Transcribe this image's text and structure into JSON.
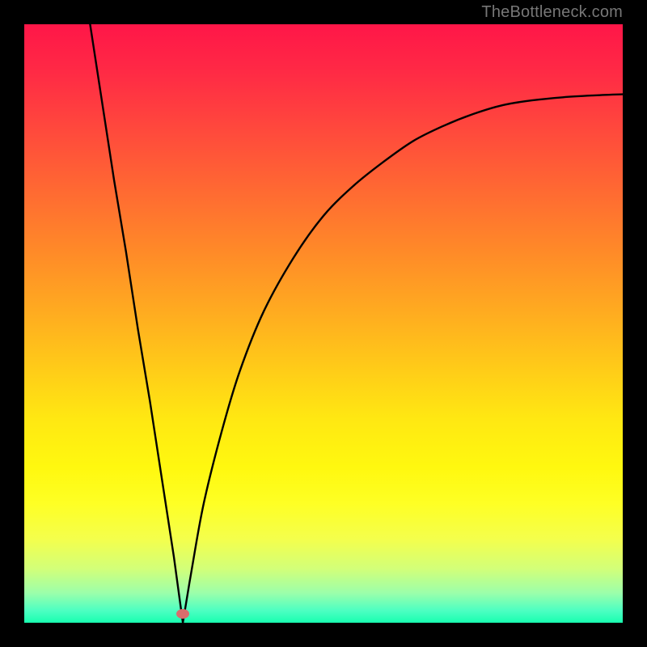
{
  "attribution": "TheBottleneck.com",
  "colors": {
    "frame": "#000000",
    "curve": "#000000",
    "marker": "#d96d6d"
  },
  "chart_data": {
    "type": "line",
    "title": "",
    "xlabel": "",
    "ylabel": "",
    "xlim": [
      0,
      100
    ],
    "ylim": [
      0,
      100
    ],
    "grid": false,
    "legend": false,
    "annotations": [
      {
        "text": "TheBottleneck.com",
        "position": "top-right"
      }
    ],
    "marker": {
      "x": 26.5,
      "y": 1.5,
      "shape": "ellipse",
      "color": "#d96d6d"
    },
    "series": [
      {
        "name": "bottleneck-curve",
        "x": [
          11,
          13,
          15,
          17,
          19,
          21,
          23,
          25,
          26.5,
          28,
          30,
          33,
          36,
          40,
          45,
          50,
          55,
          60,
          65,
          70,
          75,
          80,
          85,
          90,
          95,
          100
        ],
        "values": [
          100,
          87,
          74,
          62,
          49,
          37,
          24,
          11,
          0,
          9,
          20,
          32,
          42,
          52,
          61,
          68,
          73,
          77,
          80.5,
          83,
          85,
          86.5,
          87.3,
          87.8,
          88.1,
          88.3
        ]
      }
    ]
  }
}
